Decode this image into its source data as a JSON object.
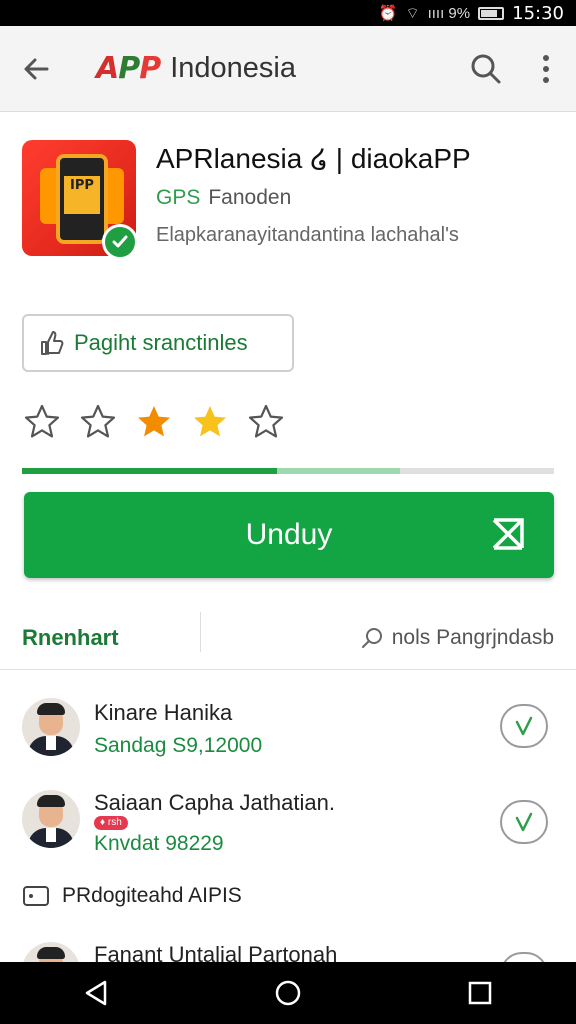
{
  "status_bar": {
    "signal_text": "ıııı 9%",
    "clock": "15:30"
  },
  "appbar": {
    "logo_mark": [
      "A",
      "P",
      "P"
    ],
    "title": "Indonesia",
    "icons": {
      "back": "arrow-left-icon",
      "search": "search-icon",
      "more": "more-vert-icon"
    }
  },
  "app": {
    "title": "APRlanesia ໒ | diaokaPP",
    "developer_tag": "GPS",
    "developer": "Fanoden",
    "description": "Elapkaranayitandantina lachahal's",
    "icon_text": "IPP"
  },
  "secondary_button": {
    "label": "Pagiht sranctinles"
  },
  "rating": {
    "stars": 5,
    "filled": [
      false,
      false,
      true,
      true,
      false
    ]
  },
  "progress": {
    "value": 0.48,
    "buffer": 0.71
  },
  "download": {
    "label": "Unduy"
  },
  "tabs": {
    "left": "Rnenhart",
    "right": "nols Pangrjndasb"
  },
  "list": [
    {
      "name": "Kinare Hanika",
      "sub": "Sandag S9,12000",
      "pill": ""
    },
    {
      "name": "Saiaan Capha Jathatian.",
      "sub": "Knvdat 98229",
      "pill": "♦ rsh"
    }
  ],
  "section": {
    "label": "PRdogiteahd AIPIS"
  },
  "partial_item": {
    "name": "Fanant Untalial Partonah"
  },
  "colors": {
    "primary": "#13a543",
    "accent": "#1b7a35",
    "star": "#f6a000"
  }
}
